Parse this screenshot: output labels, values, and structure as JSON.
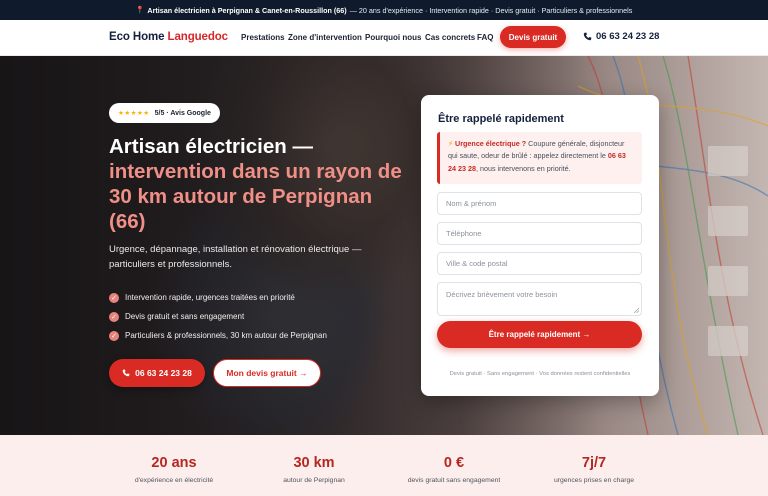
{
  "topbar": {
    "highlight": "Artisan électricien à Perpignan & Canet-en-Roussillon (66)",
    "rest": "— 20 ans d'expérience · Intervention rapide · Devis gratuit · Particuliers & professionnels",
    "icon": "pin-icon"
  },
  "header": {
    "logo_part1": "Eco Home",
    "logo_part2": "Languedoc",
    "nav": [
      "Prestations",
      "Zone d'intervention",
      "Pourquoi nous",
      "Cas concrets",
      "FAQ"
    ],
    "cta": "Devis gratuit",
    "phone": "06 63 24 23 28"
  },
  "hero": {
    "rating_stars": "★★★★★",
    "rating_text": "5/5 · Avis Google",
    "title_line1": "Artisan électricien —",
    "title_line2": "intervention dans un rayon de 30 km autour de Perpignan (66)",
    "lead": "Urgence, dépannage, installation et rénovation électrique — particuliers et professionnels.",
    "checks": [
      "Intervention rapide, urgences traitées en priorité",
      "Devis gratuit et sans engagement",
      "Particuliers & professionnels, 30 km autour de Perpignan"
    ],
    "btn_call": "06 63 24 23 28",
    "btn_quote": "Mon devis gratuit →"
  },
  "form": {
    "title": "Être rappelé rapidement",
    "alert_label": "Urgence électrique ?",
    "alert_text": "Coupure générale, disjoncteur qui saute, odeur de brûlé : appelez directement le",
    "alert_phone": "06 63 24 23 28",
    "alert_end": ", nous intervenons en priorité.",
    "placeholders": {
      "name": "Nom & prénom",
      "phone": "Téléphone",
      "city": "Ville & code postal",
      "need": "Décrivez brièvement votre besoin"
    },
    "submit": "Être rappelé rapidement →",
    "fineprint": "Devis gratuit · Sans engagement · Vos données restent confidentielles"
  },
  "stats": [
    {
      "value": "20 ans",
      "label": "d'expérience en électricité"
    },
    {
      "value": "30 km",
      "label": "autour de Perpignan"
    },
    {
      "value": "0 €",
      "label": "devis gratuit sans engagement"
    },
    {
      "value": "7j/7",
      "label": "urgences prises en charge"
    }
  ],
  "colors": {
    "brand_red": "#d92b24",
    "navy": "#14213d",
    "accent_pink": "#f08f87"
  }
}
